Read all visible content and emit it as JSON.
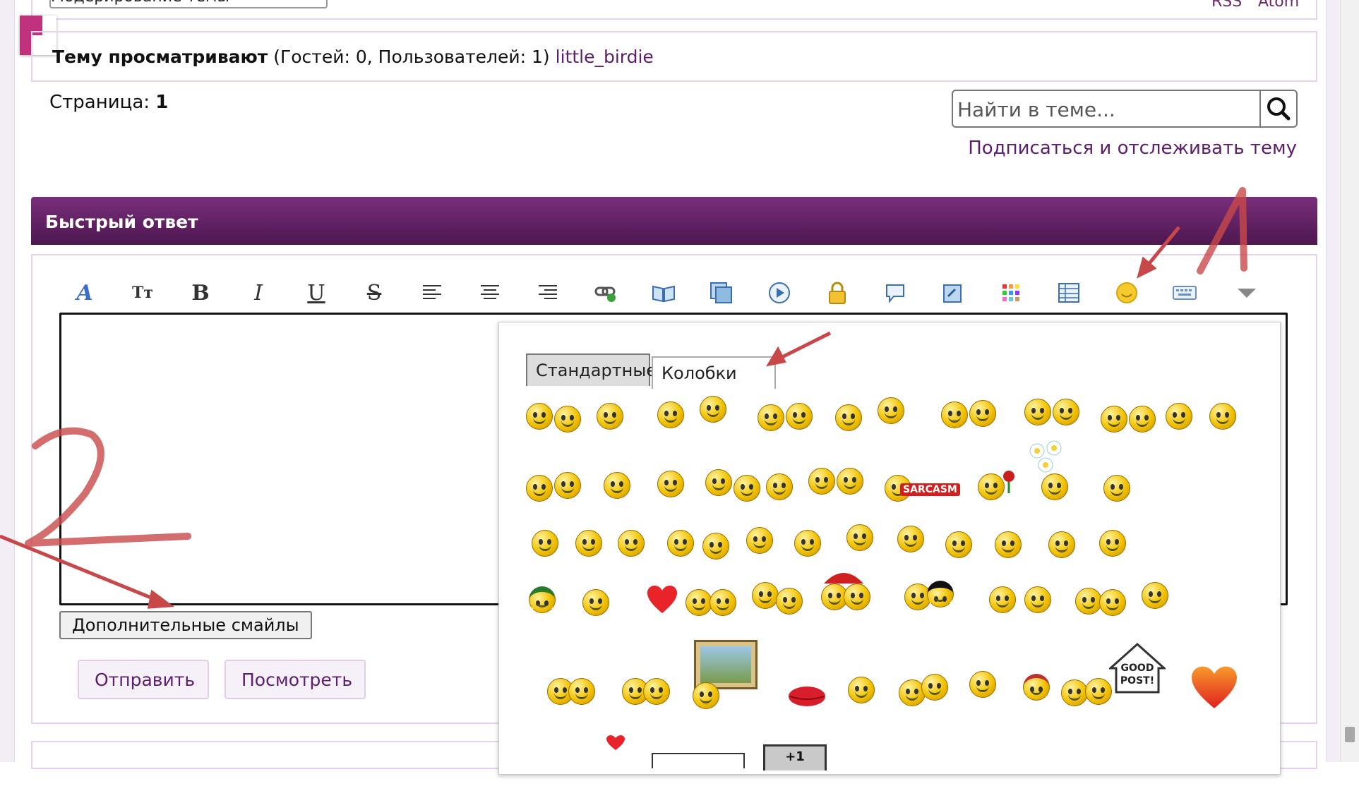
{
  "topbar": {
    "moderation_select": "Модерирование темы",
    "rss": "RSS",
    "atom": "Atom"
  },
  "viewers": {
    "bold": "Тему просматривают",
    "counts": " (Гостей: 0, Пользователей: 1) ",
    "user": "little_birdie"
  },
  "pagination": {
    "label": "Страница: ",
    "current": "1"
  },
  "search": {
    "placeholder": "Найти в теме..."
  },
  "subscribe": {
    "label": "Подписаться и отслеживать тему"
  },
  "quick_reply": {
    "title": "Быстрый ответ",
    "more_smiles": "Дополнительные смайлы",
    "submit": "Отправить",
    "preview": "Посмотреть"
  },
  "smiley_panel": {
    "tabs": [
      "Стандартные",
      "Колобки"
    ],
    "sarcasm_label": "SARCASM",
    "good_post": [
      "GOOD",
      "POST!"
    ],
    "sign_partial": "+1"
  },
  "annotations": [
    "1",
    "2"
  ],
  "colors": {
    "header_gradient_top": "#7a2e7b",
    "header_gradient_bottom": "#4d174f",
    "link": "#5b1f6b",
    "panel_border": "#e6d2ee",
    "annotation_red": "#c8484a"
  },
  "toolbar_icons": [
    "font-color-icon",
    "font-size-icon",
    "bold-icon",
    "italic-icon",
    "underline-icon",
    "strikethrough-icon",
    "align-left-icon",
    "align-center-icon",
    "align-right-icon",
    "link-icon",
    "quote-book-icon",
    "media-gallery-icon",
    "video-play-icon",
    "lock-icon",
    "speech-bubble-icon",
    "image-insert-icon",
    "color-grid-icon",
    "table-icon",
    "smiley-icon",
    "keyboard-icon",
    "more-dropdown-icon"
  ]
}
